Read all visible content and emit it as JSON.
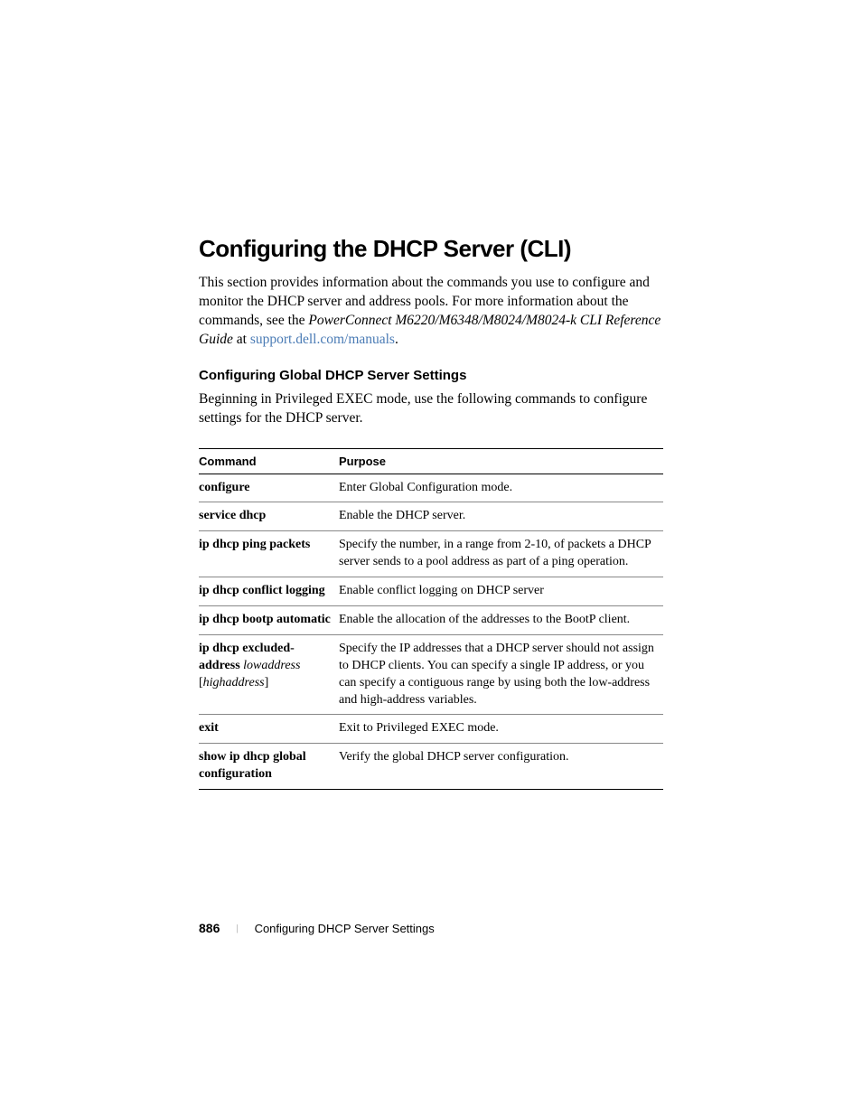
{
  "heading": "Configuring the DHCP Server (CLI)",
  "intro": {
    "part1": "This section provides information about the commands you use to configure and monitor the DHCP server and address pools. For more information about the commands, see the ",
    "title": "PowerConnect M6220/M6348/M8024/M8024-k CLI Reference Guide",
    "at": " at ",
    "link": "support.dell.com/manuals",
    "period": "."
  },
  "subheading": "Configuring Global DHCP Server Settings",
  "subpara": "Beginning in Privileged EXEC mode, use the following commands to configure settings for the DHCP server.",
  "table": {
    "headers": {
      "command": "Command",
      "purpose": "Purpose"
    },
    "rows": [
      {
        "command": "configure",
        "purpose": "Enter Global Configuration mode."
      },
      {
        "command": "service dhcp",
        "purpose": "Enable the DHCP server."
      },
      {
        "command": "ip dhcp ping packets",
        "purpose": "Specify the number, in a range from 2-10, of packets a DHCP server sends to a pool address as part of a ping operation."
      },
      {
        "command": "ip dhcp conflict logging",
        "purpose": "Enable conflict logging on DHCP server"
      },
      {
        "command": "ip dhcp bootp automatic",
        "purpose": "Enable the allocation of the addresses to the BootP client."
      },
      {
        "command_prefix": "ip dhcp excluded-address",
        "command_param1": "lowaddress",
        "bracket_open": "[",
        "command_param2": "highaddress",
        "bracket_close": "]",
        "purpose": "Specify the IP addresses that a DHCP server should not assign to DHCP clients. You can specify a single IP address, or you can specify a contiguous range by using both the low-address and high-address variables."
      },
      {
        "command": "exit",
        "purpose": "Exit to Privileged EXEC mode."
      },
      {
        "command": "show ip dhcp global configuration",
        "purpose": "Verify the global DHCP server configuration."
      }
    ]
  },
  "footer": {
    "page": "886",
    "title": "Configuring DHCP Server Settings"
  }
}
